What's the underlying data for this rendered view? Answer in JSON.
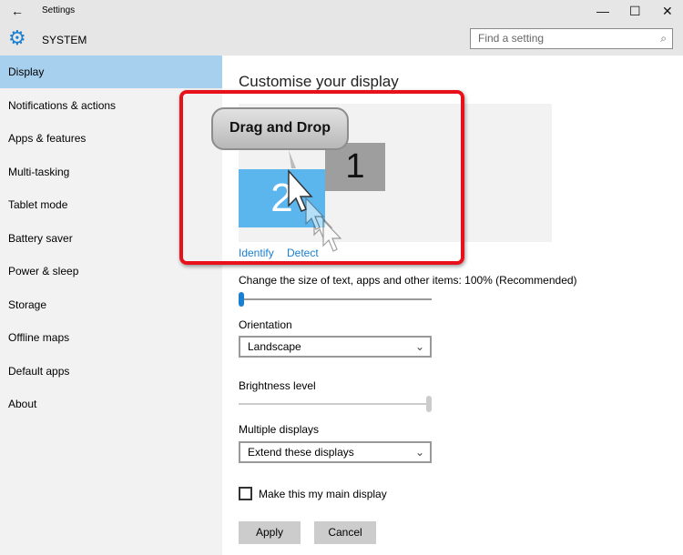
{
  "window": {
    "title": "Settings",
    "back_icon": "←",
    "minimize": "—",
    "maximize": "☐",
    "close": "✕"
  },
  "header": {
    "section": "SYSTEM",
    "search_placeholder": "Find a setting"
  },
  "sidebar": {
    "items": [
      {
        "label": "Display"
      },
      {
        "label": "Notifications & actions"
      },
      {
        "label": "Apps & features"
      },
      {
        "label": "Multi-tasking"
      },
      {
        "label": "Tablet mode"
      },
      {
        "label": "Battery saver"
      },
      {
        "label": "Power & sleep"
      },
      {
        "label": "Storage"
      },
      {
        "label": "Offline maps"
      },
      {
        "label": "Default apps"
      },
      {
        "label": "About"
      }
    ]
  },
  "main": {
    "title": "Customise your display",
    "monitors": {
      "one": "1",
      "two": "2"
    },
    "identify": "Identify",
    "detect": "Detect",
    "callout": "Drag and Drop",
    "scale_label": "Change the size of text, apps and other items: 100% (Recommended)",
    "scale_value_fraction": 0,
    "orientation_label": "Orientation",
    "orientation_value": "Landscape",
    "brightness_label": "Brightness level",
    "brightness_value_fraction": 1,
    "multiple_label": "Multiple displays",
    "multiple_value": "Extend these displays",
    "main_display_label": "Make this my main display",
    "main_display_checked": false,
    "apply": "Apply",
    "cancel": "Cancel"
  },
  "colors": {
    "accent": "#5cb6ee",
    "selected": "#a7cfee",
    "highlight": "#e8101a"
  }
}
